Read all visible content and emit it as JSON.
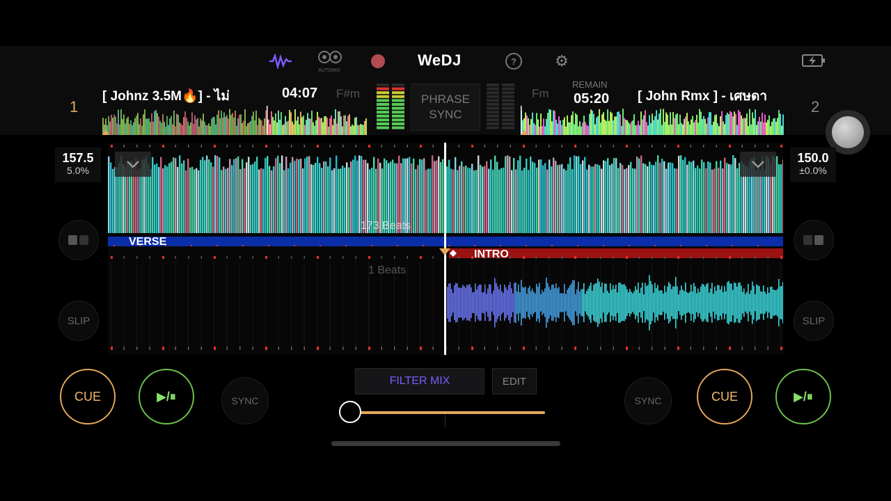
{
  "header": {
    "app_title": "WeDJ",
    "waveform_icon": "waveform-icon",
    "automix_label": "AUTOMIX",
    "record_icon": "record-icon",
    "help_icon": "help-icon",
    "settings_icon": "gear-icon",
    "battery_icon": "battery-charging-icon"
  },
  "deck1": {
    "number": "1",
    "title": "[ Johnz 3.5M🔥] - ไม่",
    "time": "04:07",
    "key": "F#m",
    "bpm": "157.5",
    "pitch": "5.0%",
    "beats_label": "173 Beats",
    "phrase_label": "VERSE",
    "slip_label": "SLIP",
    "cue_label": "CUE",
    "play_label": "▶/⏸",
    "sync_label": "SYNC"
  },
  "deck2": {
    "number": "2",
    "title": "[ John Rmx ] - เศษดา",
    "remain_label": "REMAIN",
    "time": "05:20",
    "key": "Fm",
    "bpm": "150.0",
    "pitch": "±0.0%",
    "beats_label": "1 Beats",
    "phrase_label": "INTRO",
    "slip_label": "SLIP",
    "cue_label": "CUE",
    "play_label": "▶/⏸",
    "sync_label": "SYNC"
  },
  "center": {
    "phrase_sync_line1": "PHRASE",
    "phrase_sync_line2": "SYNC",
    "filter_mix_label": "FILTER MIX",
    "edit_label": "EDIT"
  },
  "colors": {
    "accent_purple": "#7b5cff",
    "cue_orange": "#e6a85c",
    "play_green": "#6ec24a",
    "phrase_verse": "#0a2ea8",
    "phrase_intro": "#9a1212",
    "waveform_cyan": "#3fe3d8"
  },
  "crossfader": {
    "position_percent": 0
  }
}
